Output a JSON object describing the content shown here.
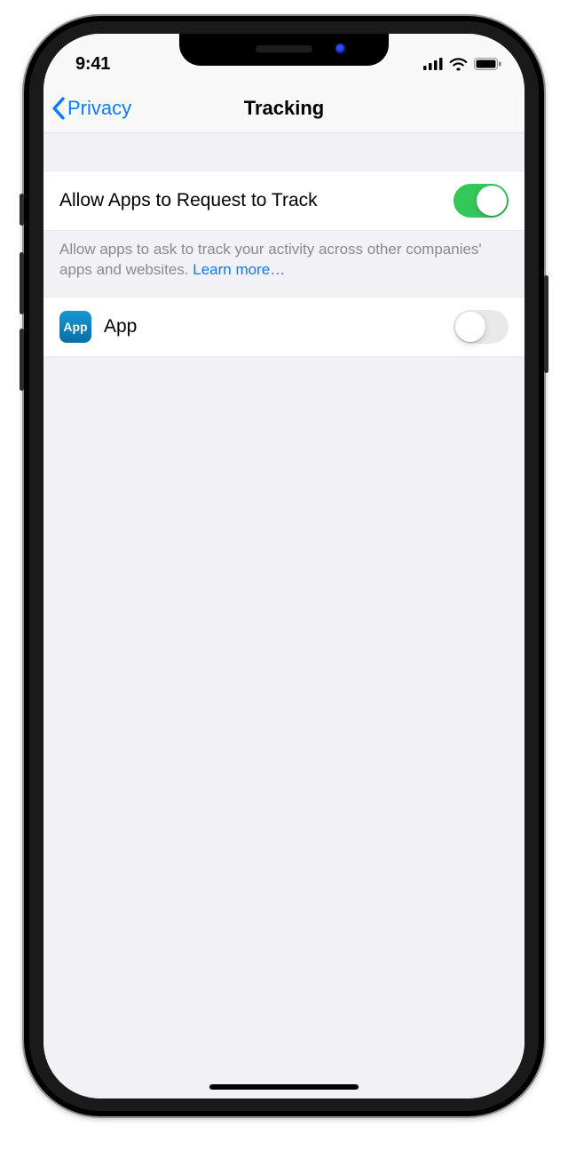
{
  "status": {
    "time": "9:41"
  },
  "nav": {
    "back_label": "Privacy",
    "title": "Tracking"
  },
  "rows": {
    "allow_label": "Allow Apps to Request to Track",
    "allow_on": true,
    "footer_text": "Allow apps to ask to track your activity across other companies' apps and websites. ",
    "learn_more": "Learn more…",
    "app_icon_text": "App",
    "app_name": "App",
    "app_on": false
  },
  "colors": {
    "tint": "#0a7aff",
    "toggle_on": "#34c759"
  }
}
